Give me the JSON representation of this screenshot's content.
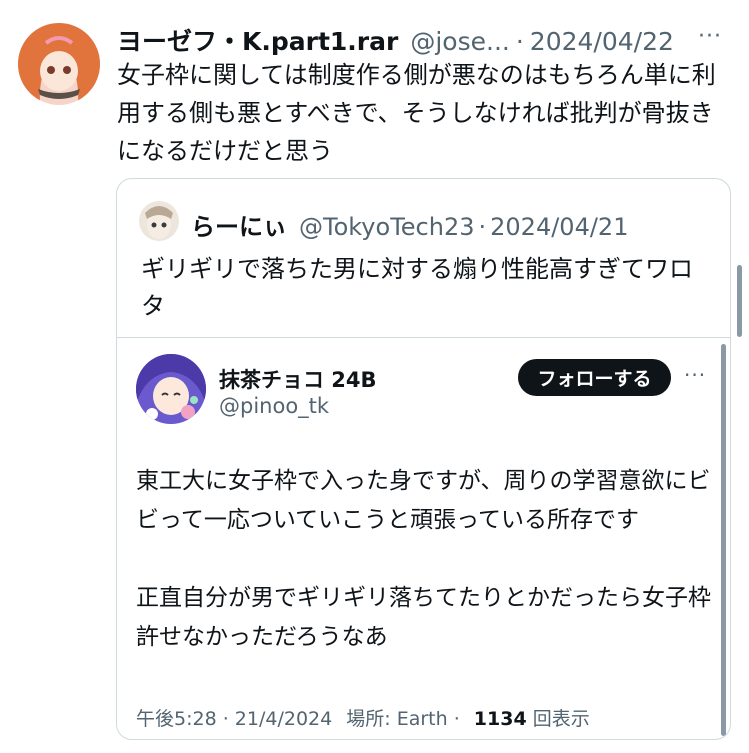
{
  "main_tweet": {
    "name": "ヨーゼフ・K.part1.rar",
    "handle": "@jose...",
    "separator": "·",
    "date": "2024/04/22",
    "more": "···",
    "text": "女子枠に関しては制度作る側が悪なのはもちろん単に利用する側も悪とすべきで、そうしなければ批判が骨抜きになるだけだと思う"
  },
  "quoted_tweet": {
    "name": "らーにぃ",
    "handle": "@TokyoTech23",
    "separator": "·",
    "date": "2024/04/21",
    "text": "ギリギリで落ちた男に対する煽り性能高すぎてワロタ"
  },
  "embedded_tweet": {
    "name": "抹茶チョコ 24B",
    "handle": "@pinoo_tk",
    "follow_label": "フォローする",
    "more": "···",
    "text_p1": "東工大に女子枠で入った身ですが、周りの学習意欲にビビって一応ついていこうと頑張っている所存です",
    "text_p2": "正直自分が男でギリギリ落ちてたりとかだったら女子枠許せなかっただろうなあ",
    "meta_time": "午後5:28 · 21/4/2024",
    "meta_location": "場所: Earth ·",
    "meta_views_count": "1134",
    "meta_views_label": "回表示"
  },
  "colors": {
    "text": "#0f1419",
    "muted": "#536471",
    "border": "#cfd9de",
    "button": "#0f1419"
  }
}
